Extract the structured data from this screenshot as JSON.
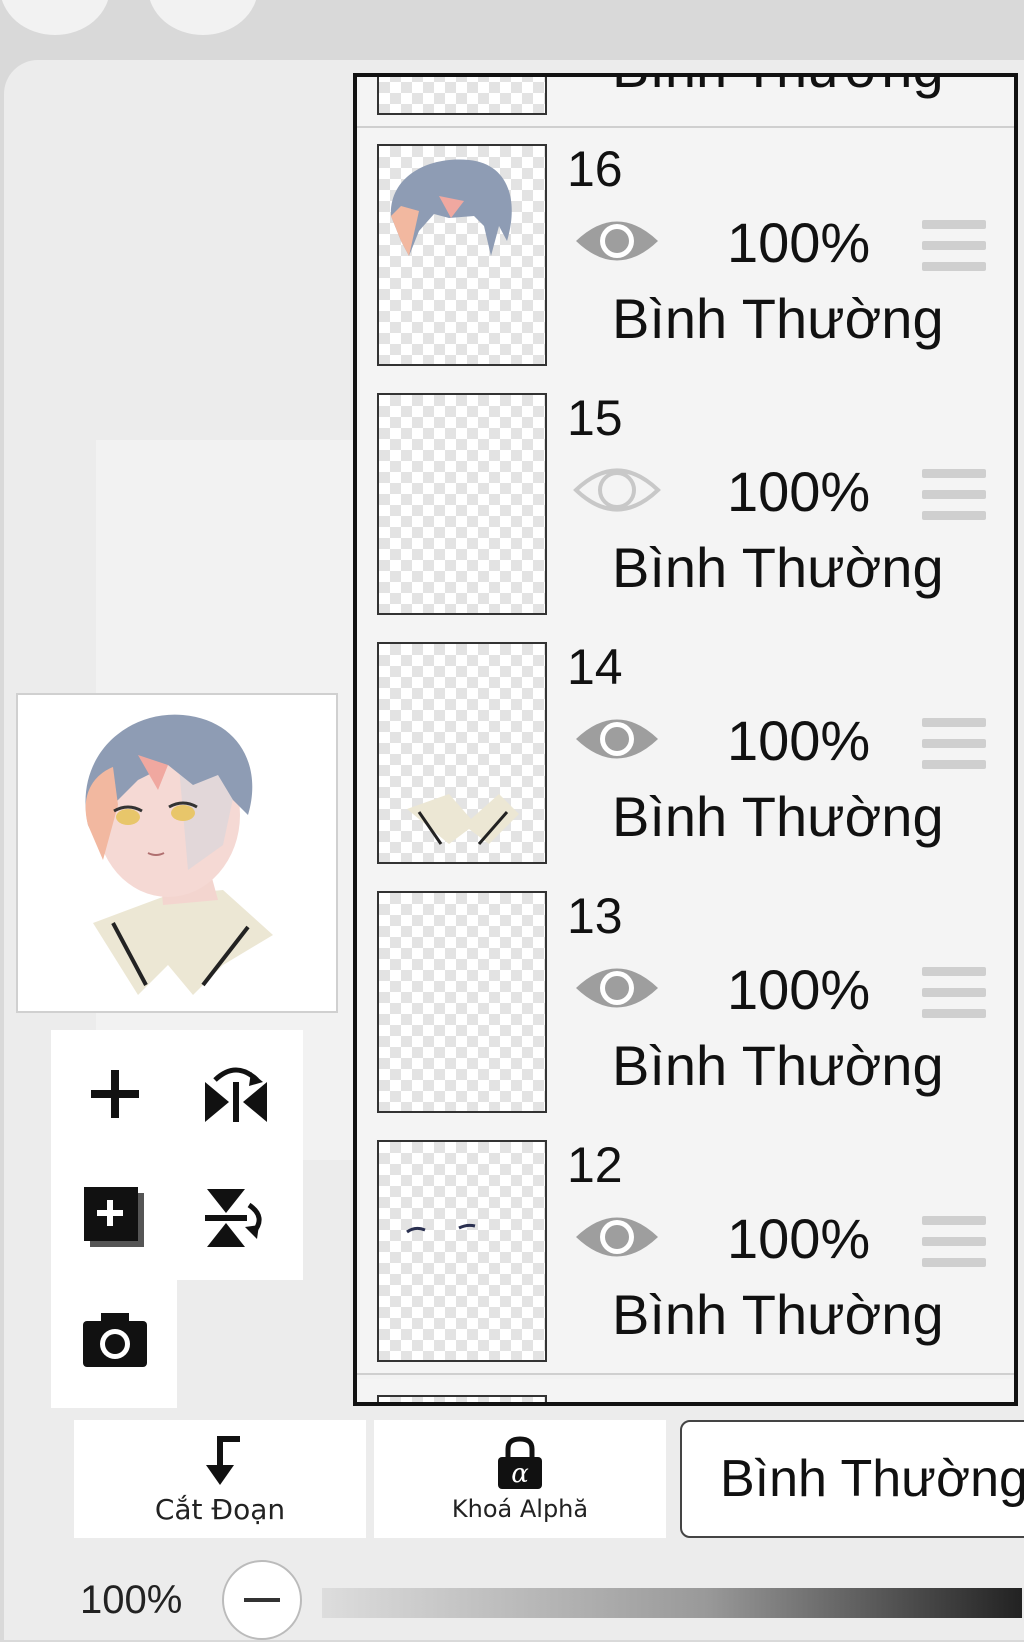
{
  "layers_partial_top": {
    "blend": "Bình Thường"
  },
  "layers": [
    {
      "number": "16",
      "visible": true,
      "opacity": "100%",
      "blend": "Bình Thường",
      "thumb": "hair"
    },
    {
      "number": "15",
      "visible": false,
      "opacity": "100%",
      "blend": "Bình Thường",
      "thumb": "empty"
    },
    {
      "number": "14",
      "visible": true,
      "opacity": "100%",
      "blend": "Bình Thường",
      "thumb": "collar"
    },
    {
      "number": "13",
      "visible": true,
      "opacity": "100%",
      "blend": "Bình Thường",
      "thumb": "empty"
    },
    {
      "number": "12",
      "visible": true,
      "opacity": "100%",
      "blend": "Bình Thường",
      "thumb": "brows"
    }
  ],
  "tools": {
    "add_layer": "plus-icon",
    "flip": "flip-horizontal-icon",
    "add_layer_boxed": "add-layer-box-icon",
    "merge_down": "merge-down-icon",
    "camera": "camera-icon"
  },
  "bottom_bar": {
    "clip_label": "Cắt Đoạn",
    "alpha_lock_label": "Khoá Alphă",
    "blend_mode_value": "Bình Thường"
  },
  "zoom": {
    "label": "100%",
    "minus": "−"
  },
  "colors": {
    "panel_bg": "#ececec",
    "row_bg": "#f4f4f4",
    "eye_visible": "#9e9e9e",
    "eye_hidden": "#c8c8c8",
    "hair": "#8e9cb4",
    "hair_warm": "#f2b8a0"
  }
}
